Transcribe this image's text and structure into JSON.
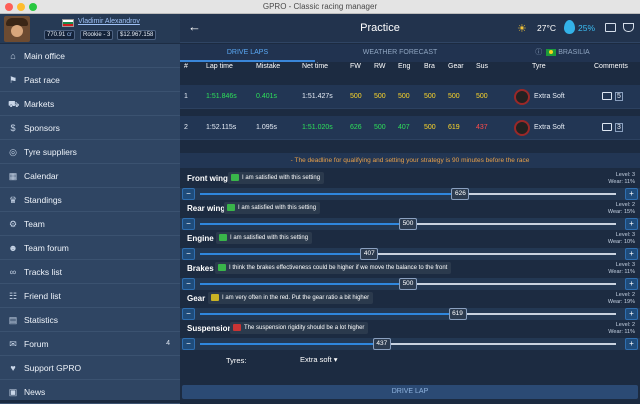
{
  "window": {
    "title": "GPRO - Classic racing manager"
  },
  "profile": {
    "name": "Vladimir Alexandrov",
    "points": "770.91",
    "points_icon": "cr",
    "level": "Rookie - 3",
    "money": "$12.967.158"
  },
  "sidebar": {
    "items": [
      {
        "label": "Main office",
        "icon": "home-icon"
      },
      {
        "label": "Past race",
        "icon": "flag-icon"
      },
      {
        "label": "Markets",
        "icon": "cart-icon"
      },
      {
        "label": "Sponsors",
        "icon": "dollar-icon"
      },
      {
        "label": "Tyre suppliers",
        "icon": "tyre-icon"
      },
      {
        "label": "Calendar",
        "icon": "calendar-icon"
      },
      {
        "label": "Standings",
        "icon": "trophy-icon"
      },
      {
        "label": "Team",
        "icon": "gear-icon"
      },
      {
        "label": "Team forum",
        "icon": "users-icon"
      },
      {
        "label": "Tracks list",
        "icon": "track-icon"
      },
      {
        "label": "Friend list",
        "icon": "friends-icon"
      },
      {
        "label": "Statistics",
        "icon": "stats-icon"
      },
      {
        "label": "Forum",
        "icon": "forum-icon",
        "badge": "4"
      },
      {
        "label": "Support GPRO",
        "icon": "support-icon"
      },
      {
        "label": "News",
        "icon": "news-icon"
      }
    ]
  },
  "header": {
    "title": "Practice",
    "temperature": "27°C",
    "humidity": "25%"
  },
  "tabs": [
    {
      "label": "DRIVE LAPS"
    },
    {
      "label": "WEATHER FORECAST"
    },
    {
      "label": "BRASILIA"
    }
  ],
  "table": {
    "headers": [
      "#",
      "Lap time",
      "Mistake",
      "Net time",
      "FW",
      "RW",
      "Eng",
      "Bra",
      "Gear",
      "Sus",
      "Tyre",
      "Comments"
    ],
    "rows": [
      {
        "n": "1",
        "lap": "1:51.846s",
        "mistake": "0.401s",
        "net": "1:51.427s",
        "fw": "500",
        "rw": "500",
        "eng": "500",
        "bra": "500",
        "gear": "500",
        "sus": "500",
        "tyre": "Extra Soft",
        "comments": "5"
      },
      {
        "n": "2",
        "lap": "1:52.115s",
        "mistake": "1.095s",
        "net": "1:51.020s",
        "fw": "626",
        "rw": "500",
        "eng": "407",
        "bra": "500",
        "gear": "619",
        "sus": "437",
        "tyre": "Extra Soft",
        "comments": "3"
      }
    ]
  },
  "notice": "- The deadline for qualifying and setting your strategy is 90 minutes before the race",
  "settings": [
    {
      "label": "Front wing",
      "comment": "I am satisfied with this setting",
      "value": 626,
      "level": "Level: 3",
      "wear": "Wear: 11%"
    },
    {
      "label": "Rear wing",
      "comment": "I am satisfied with this setting",
      "value": 500,
      "level": "Level: 2",
      "wear": "Wear: 15%"
    },
    {
      "label": "Engine",
      "comment": "I am satisfied with this setting",
      "value": 407,
      "level": "Level: 3",
      "wear": "Wear: 10%"
    },
    {
      "label": "Brakes",
      "comment": "I think the brakes effectiveness could be higher if we move the balance to the front",
      "value": 500,
      "level": "Level: 3",
      "wear": "Wear: 11%"
    },
    {
      "label": "Gear",
      "comment": "I am very often in the red. Put the gear ratio a bit higher",
      "value": 619,
      "level": "Level: 2",
      "wear": "Wear: 19%"
    },
    {
      "label": "Suspension",
      "comment": "The suspension rigidity should be a lot higher",
      "value": 437,
      "level": "Level: 2",
      "wear": "Wear: 11%"
    }
  ],
  "tyres": {
    "label": "Tyres:",
    "selected": "Extra soft"
  },
  "drive_button": "DRIVE LAP",
  "colors": {
    "accent": "#3a86d8",
    "good": "#2ee05a",
    "warn": "#ffd829",
    "bad": "#ff4b4b"
  }
}
